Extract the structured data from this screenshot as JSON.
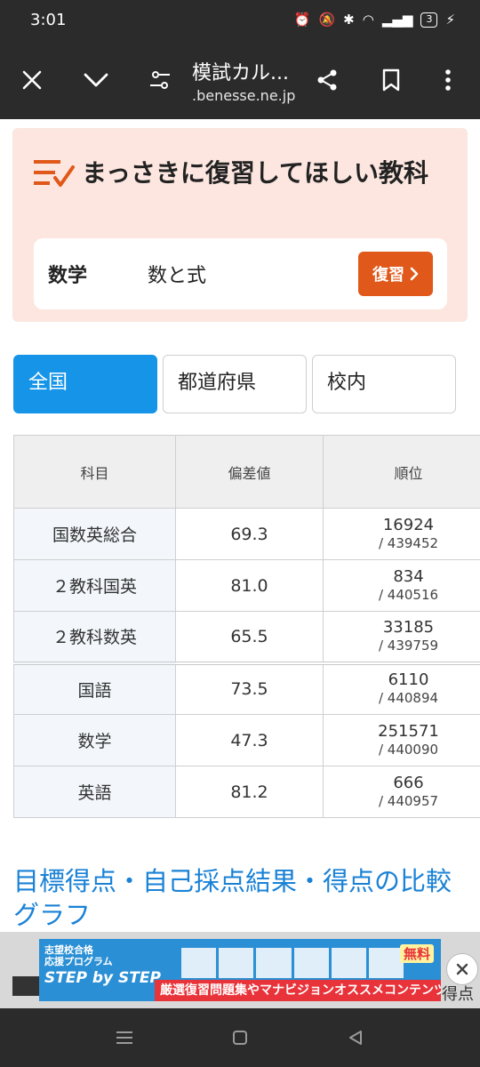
{
  "status": {
    "time": "3:01",
    "battery": "3"
  },
  "browser": {
    "title": "模試カル...",
    "url": ".benesse.ne.jp"
  },
  "review": {
    "title": "まっさきに復習してほしい教科",
    "subject": "数学",
    "topic": "数と式",
    "button_label": "復習"
  },
  "scope_tabs": [
    {
      "label": "全国",
      "active": true
    },
    {
      "label": "都道府県",
      "active": false
    },
    {
      "label": "校内",
      "active": false
    }
  ],
  "table": {
    "headers": [
      "科目",
      "偏差値",
      "順位"
    ],
    "rows": [
      {
        "subject": "国数英総合",
        "deviation": "69.3",
        "rank": "16924",
        "total": "/ 439452"
      },
      {
        "subject": "２教科国英",
        "deviation": "81.0",
        "rank": "834",
        "total": "/ 440516"
      },
      {
        "subject": "２教科数英",
        "deviation": "65.5",
        "rank": "33185",
        "total": "/ 439759"
      },
      {
        "subject": "国語",
        "deviation": "73.5",
        "rank": "6110",
        "total": "/ 440894"
      },
      {
        "subject": "数学",
        "deviation": "47.3",
        "rank": "251571",
        "total": "/ 440090"
      },
      {
        "subject": "英語",
        "deviation": "81.2",
        "rank": "666",
        "total": "/ 440957"
      }
    ]
  },
  "section_title": "目標得点・自己採点結果・得点の比較グラフ",
  "ad": {
    "program_line1": "志望校合格",
    "program_line2": "応援プログラム",
    "name": "STEP by STEP",
    "free_badge": "無料",
    "tagline": "厳選復習問題集やマナビジョンオススメコンテンツが使える!",
    "trailing_text": "得点"
  },
  "colors": {
    "accent": "#1594e8",
    "review_bg": "#fce6df",
    "review_button": "#e0581a",
    "link": "#1a82d6"
  }
}
